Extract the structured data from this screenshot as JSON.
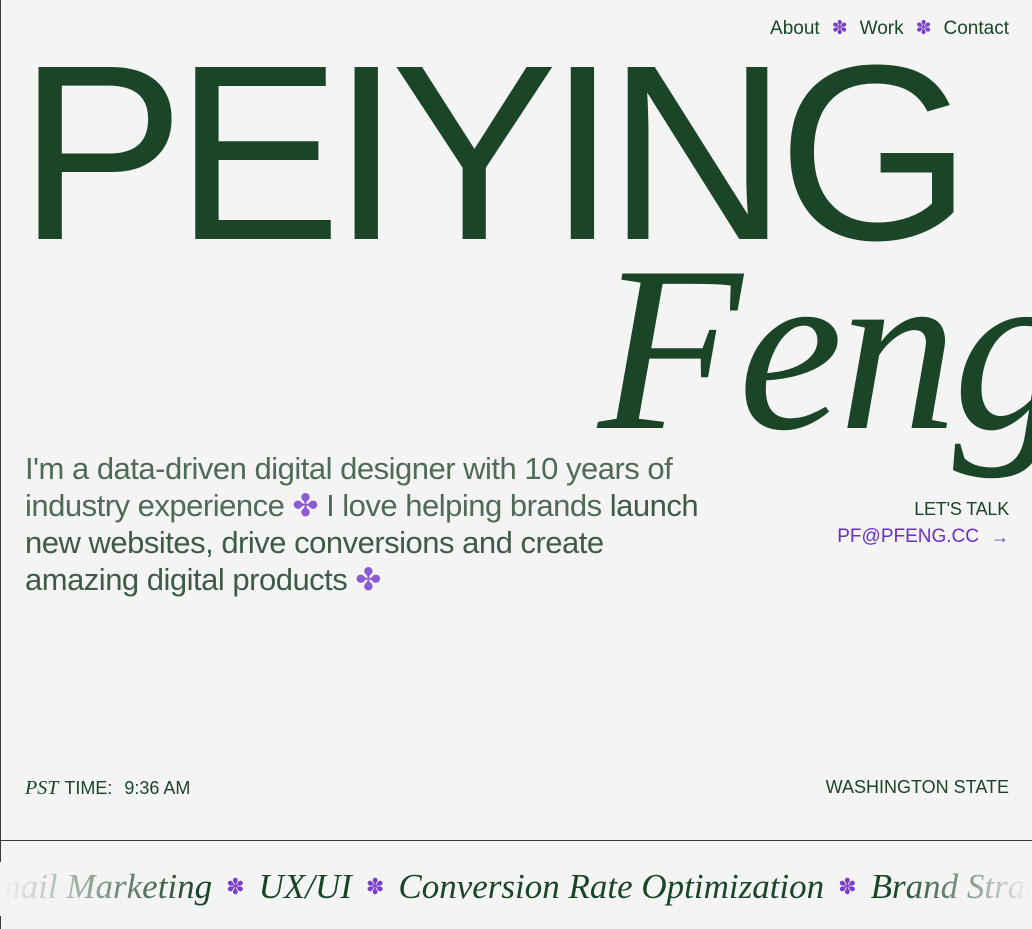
{
  "nav": {
    "items": [
      {
        "label": "About"
      },
      {
        "label": "Work"
      },
      {
        "label": "Contact"
      }
    ],
    "separator": "✽"
  },
  "hero": {
    "first_name": "PEIYING",
    "last_name": "Feng"
  },
  "intro": {
    "line1": "I'm a data-driven digital designer with 10 years of industry experience",
    "clover": "✤",
    "line2": "I love helping brands",
    "line3": "launch new websites, drive conversions and create amazing digital products"
  },
  "contact": {
    "lets_talk": "LET'S TALK",
    "email": "PF@PFENG.CC",
    "arrow": "→"
  },
  "footer_info": {
    "timezone": "PST",
    "time_label": "TIME:",
    "time_value": "9:36 AM",
    "location": "WASHINGTON STATE"
  },
  "marquee": {
    "items": [
      "Email Marketing",
      "UX/UI",
      "Conversion Rate Optimization",
      "Brand Strategy"
    ],
    "separator": "✽"
  },
  "colors": {
    "primary_green": "#1a4527",
    "accent_purple": "#7a3ec7",
    "background": "#f4f4f4"
  }
}
